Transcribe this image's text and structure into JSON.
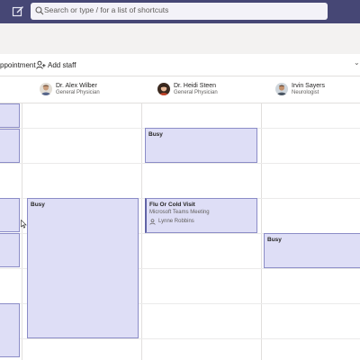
{
  "header": {
    "search_placeholder": "Search or type / for a list of shortcuts"
  },
  "toolbar": {
    "appointment_label": "ppointment",
    "add_staff_label": "Add staff"
  },
  "staff": [
    {
      "name": "Dr. Alex Wilber",
      "role": "General Physician"
    },
    {
      "name": "Dr. Heidi Steen",
      "role": "General Physician"
    },
    {
      "name": "Irvin Sayers",
      "role": "Neurologist"
    }
  ],
  "appointments": {
    "alex_busy": {
      "title": "Busy"
    },
    "heidi_busy": {
      "title": "Busy"
    },
    "heidi_visit": {
      "title": "Flu Or Cold Visit",
      "subtitle": "Microsoft Teams Meeting",
      "person": "Lynne Robbins"
    },
    "irvin_busy": {
      "title": "Busy"
    }
  },
  "colors": {
    "app_bar": "#464775",
    "appointment_fill": "#dedef6",
    "appointment_border": "#6264a7"
  }
}
